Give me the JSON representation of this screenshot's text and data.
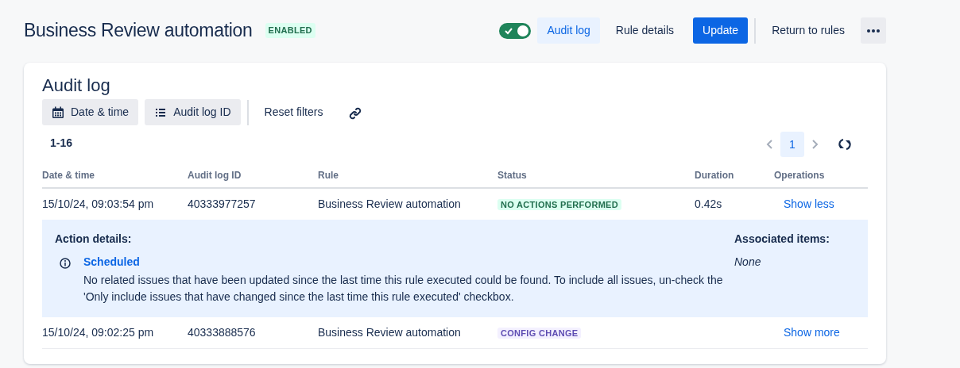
{
  "header": {
    "title": "Business Review automation",
    "status_badge": "ENABLED",
    "toggle": {
      "on": true
    },
    "nav": [
      {
        "label": "Audit log",
        "selected": true
      },
      {
        "label": "Rule details",
        "selected": false
      }
    ],
    "update_button": "Update",
    "return_link": "Return to rules"
  },
  "audit_log": {
    "title": "Audit log",
    "filters": [
      {
        "label": "Date & time",
        "kind": "calendar"
      },
      {
        "label": "Audit log ID",
        "kind": "list"
      }
    ],
    "reset_filters": "Reset filters",
    "range": "1-16",
    "pages": [
      {
        "label": "1",
        "selected": true
      }
    ],
    "columns": [
      "Date & time",
      "Audit log ID",
      "Rule",
      "Status",
      "Duration",
      "Operations"
    ],
    "rows": [
      {
        "date": "15/10/24, 09:03:54 pm",
        "id": "40333977257",
        "rule": "Business Review automation",
        "status": "NO ACTIONS PERFORMED",
        "kind": "success",
        "duration": "0.42s",
        "operation": "Show less",
        "expanded": true,
        "details": {
          "title": "Action details:",
          "action": "Scheduled",
          "message": "No related issues that have been updated since the last time this rule executed could be found. To include all issues, un-check the 'Only include issues that have changed since the last time this rule executed' checkbox.",
          "associated_title": "Associated items:",
          "associated": "None"
        }
      },
      {
        "date": "15/10/24, 09:02:25 pm",
        "id": "40333888576",
        "rule": "Business Review automation",
        "status": "CONFIG CHANGE",
        "kind": "discovery",
        "operation": "Show more",
        "expanded": false
      }
    ]
  }
}
